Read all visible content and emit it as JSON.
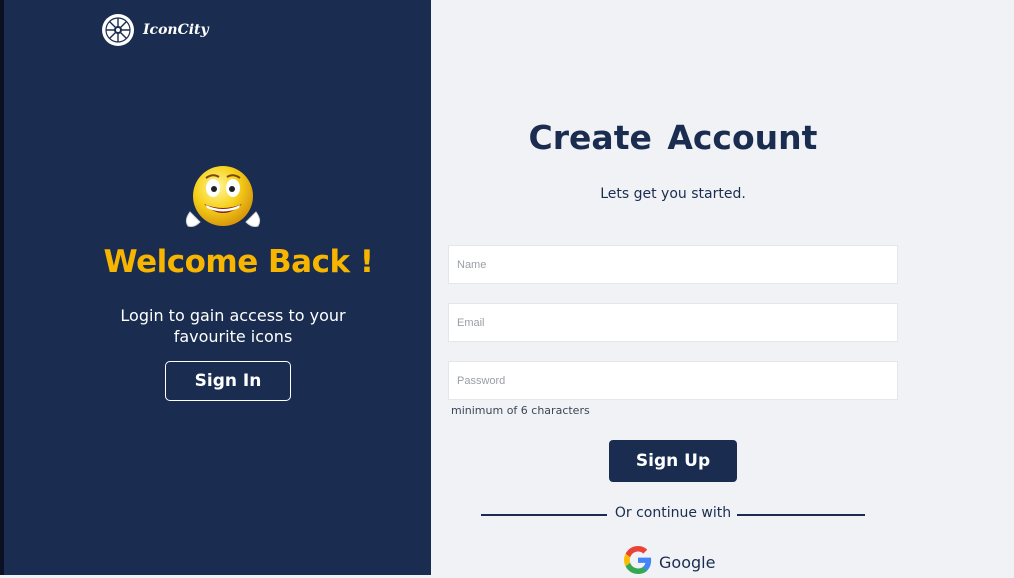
{
  "brand": {
    "name": "IconCity"
  },
  "welcome": {
    "title": "Welcome Back !",
    "subtitle": "Login to gain access to your favourite icons",
    "signin_label": "Sign In"
  },
  "form": {
    "title": "Create Account",
    "subtitle": "Lets get you started.",
    "name_placeholder": "Name",
    "email_placeholder": "Email",
    "password_placeholder": "Password",
    "password_hint": "minimum of 6 characters",
    "signup_label": "Sign Up",
    "divider_text": "Or continue with",
    "google_label": "Google"
  },
  "colors": {
    "panel": "#1a2d50",
    "accent": "#f7b500",
    "background": "#f0f2f5"
  },
  "icons": {
    "logo": "wheel-logo-icon",
    "emoji": "smiley-emoji-icon",
    "google": "google-g-icon"
  }
}
